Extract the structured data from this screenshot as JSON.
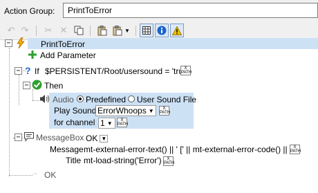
{
  "action_group": {
    "label": "Action Group:",
    "value": "PrintToError"
  },
  "toolbar": {
    "icons": [
      "undo-icon",
      "redo-icon",
      "cut-icon",
      "delete-icon",
      "copy-icon",
      "paste-icon",
      "paste-dropdown-icon",
      "grid-icon",
      "info-icon",
      "warning-icon"
    ],
    "warning_color": "#f0c000",
    "info_color": "#1c64c8"
  },
  "tree": {
    "root": "PrintToError",
    "add_parameter": "Add Parameter",
    "if_label": "If",
    "condition": "$PERSISTENT/Root/usersound = 'true'",
    "then_label": "Then",
    "audio": {
      "label": "Audio",
      "predefined": "Predefined",
      "user_sound": "User Sound File",
      "play_sound_label": "Play Sound",
      "play_sound_value": "ErrorWhoops",
      "channel_label": "for channel",
      "channel_value": "1"
    },
    "messagebox": {
      "label": "MessageBox",
      "button_value": "OK",
      "message_label": "Message",
      "message_value": "mt-external-error-text() || ' [' || mt-external-error-code() || ']'",
      "title_label": "Title",
      "title_value": "mt-load-string('Error')"
    },
    "ok_label": "OK"
  },
  "xpath_label": "X\nPATH",
  "colors": {
    "selection": "#cde1f5",
    "add_green": "#2ea02e",
    "then_green": "#2ea02e"
  }
}
